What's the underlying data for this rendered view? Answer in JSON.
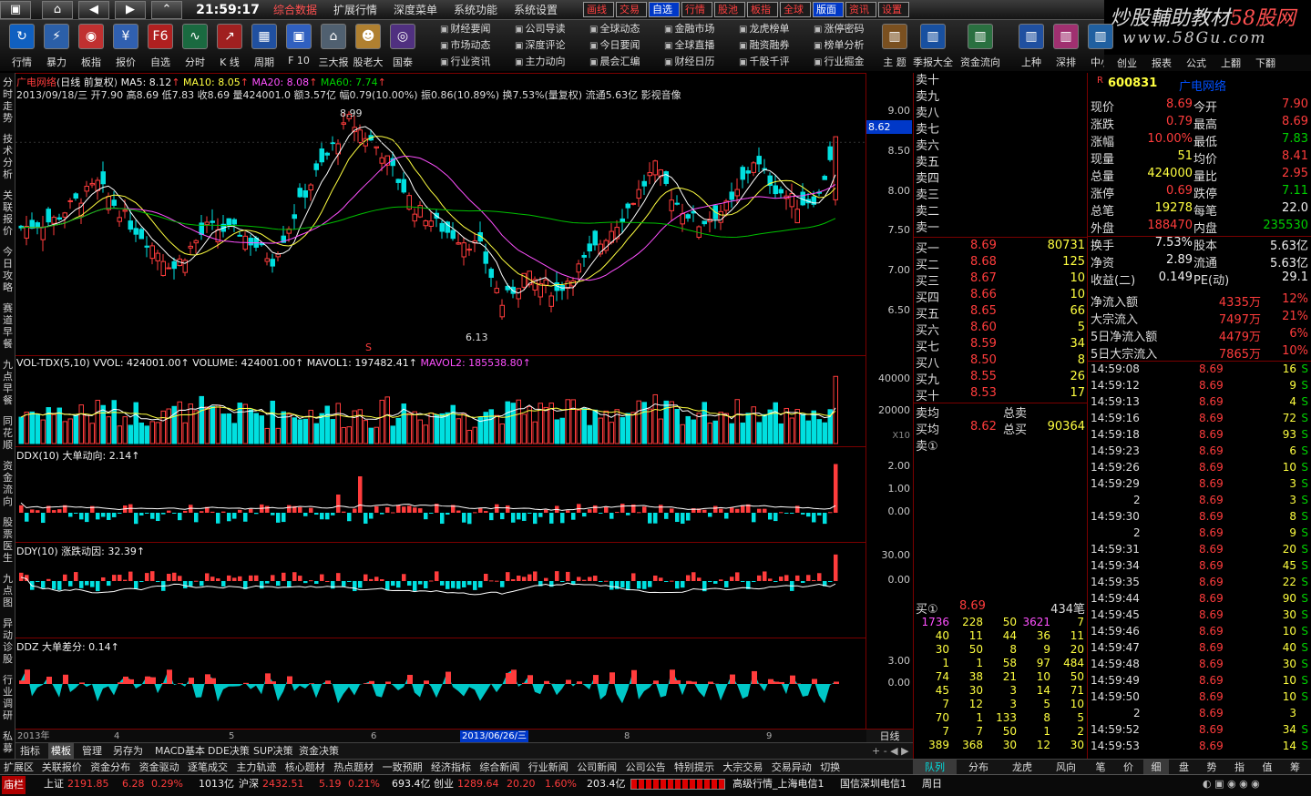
{
  "menubar": {
    "clock": "21:59:17",
    "menus": [
      "综合数据",
      "扩展行情",
      "深度菜单",
      "系统功能",
      "系统设置"
    ],
    "active_menu": "综合数据",
    "top_buttons": [
      "画线",
      "交易",
      "自选",
      "行情",
      "股池",
      "板指",
      "全球",
      "版面",
      "资讯",
      "设置"
    ],
    "highlight_buttons": [
      "自选",
      "版面"
    ]
  },
  "watermark": {
    "line1_a": "炒股輔助教材",
    "line1_b": "58股网",
    "line2": "www.58Gu.com"
  },
  "toolbar": {
    "tools": [
      "行情",
      "暴力",
      "板指",
      "报价",
      "自选",
      "分时",
      "K 线",
      "周期",
      "F 10",
      "三大报",
      "股老大",
      "国泰"
    ],
    "links": [
      "财经要闻",
      "公司导读",
      "全球动态",
      "金融市场",
      "龙虎榜单",
      "涨停密码",
      "市场动态",
      "深度评论",
      "今日要闻",
      "全球直播",
      "融资融券",
      "榜单分析",
      "行业资讯",
      "主力动向",
      "晨会汇编",
      "财经日历",
      "千股千评",
      "行业掘金"
    ],
    "tools_right": [
      "主 题",
      "季报大全",
      "资金流向",
      "上种",
      "深排",
      "中小",
      "创业",
      "报表",
      "公式",
      "上翻",
      "下翻"
    ]
  },
  "left_tabs": [
    "分时走势",
    "技术分析",
    "关联报价",
    "今日攻略",
    "赛道早餐",
    "九点早餐",
    "同花顺",
    "资金流向",
    "股票医生",
    "九点图",
    "异动诊股",
    "行业调研",
    "私募"
  ],
  "kline": {
    "title_code": "广电网络",
    "period": "日线 前复权",
    "ma5": "MA5: 8.12",
    "ma10": "MA10: 8.05",
    "ma20": "MA20: 8.08",
    "ma60": "MA60: 7.74",
    "info_line": "2013/09/18/三 开7.90 高8.69 低7.83 收8.69 量424001.0 额3.57亿 幅0.79(10.00%) 振0.86(10.89%) 换7.53%(量复权) 流通5.63亿 影视音像",
    "high_label": "8.99",
    "low_label": "6.13",
    "s_marker": "S",
    "current_price": "8.62",
    "yticks": [
      "9.00",
      "8.50",
      "8.00",
      "7.50",
      "7.00",
      "6.50"
    ]
  },
  "vol": {
    "title": "VOL-TDX(5,10) VVOL: 424001.00↑   VOLUME: 424001.00↑   MAVOL1: 197482.41↑",
    "mavol2": "MAVOL2: 185538.80↑",
    "yticks": [
      "40000",
      "20000"
    ],
    "unit": "X10"
  },
  "ddx": {
    "title": "DDX(10) 大单动向: 2.14↑",
    "yticks": [
      "2.00",
      "1.00",
      "0.00"
    ]
  },
  "ddy": {
    "title": "DDY(10) 涨跌动因: 32.39↑",
    "yticks": [
      "30.00",
      "0.00"
    ]
  },
  "ddz": {
    "title": "DDZ 大单差分: 0.14↑",
    "yticks": [
      "3.00",
      "0.00"
    ]
  },
  "datebar": {
    "labels": [
      "2013年",
      "4",
      "5",
      "6",
      "2013/06/26/三",
      "8",
      "9"
    ],
    "period_btn": "日线"
  },
  "bottom_tabs1": [
    "指标",
    "模板",
    "管理",
    "另存为",
    "MACD基本",
    "DDE决策",
    "SUP决策",
    "资金决策"
  ],
  "bottom_tabs2": [
    "扩展区",
    "关联报价",
    "资金分布",
    "资金驱动",
    "逐笔成交",
    "主力轨迹",
    "核心题材",
    "热点题材",
    "一致预期",
    "经济指标",
    "综合新闻",
    "行业新闻",
    "公司新闻",
    "公司公告",
    "特别提示",
    "大宗交易",
    "交易异动",
    "切换"
  ],
  "quote_tabs": [
    "队列",
    "分布",
    "龙虎",
    "风向",
    "笔",
    "价",
    "细",
    "盘",
    "势",
    "指",
    "值",
    "筹"
  ],
  "orderbook": {
    "sell_labels": [
      "卖十",
      "卖九",
      "卖八",
      "卖七",
      "卖六",
      "卖五",
      "卖四",
      "卖三",
      "卖二",
      "卖一"
    ],
    "buy": [
      {
        "label": "买一",
        "price": "8.69",
        "vol": "80731"
      },
      {
        "label": "买二",
        "price": "8.68",
        "vol": "125"
      },
      {
        "label": "买三",
        "price": "8.67",
        "vol": "10"
      },
      {
        "label": "买四",
        "price": "8.66",
        "vol": "10"
      },
      {
        "label": "买五",
        "price": "8.65",
        "vol": "66"
      },
      {
        "label": "买六",
        "price": "8.60",
        "vol": "5"
      },
      {
        "label": "买七",
        "price": "8.59",
        "vol": "34"
      },
      {
        "label": "买八",
        "price": "8.50",
        "vol": "8"
      },
      {
        "label": "买九",
        "price": "8.55",
        "vol": "26"
      },
      {
        "label": "买十",
        "price": "8.53",
        "vol": "17"
      }
    ],
    "avg_sell_label": "卖均",
    "total_sell_label": "总卖",
    "avg_buy_label": "买均",
    "avg_buy": "8.62",
    "total_buy_label": "总买",
    "total_buy": "90364",
    "sell_queue_label": "卖①",
    "buy_queue": {
      "label": "买①",
      "price": "8.69",
      "count": "434笔"
    },
    "queue_rows": [
      [
        "1736",
        "228",
        "50",
        "3621",
        "7"
      ],
      [
        "40",
        "11",
        "44",
        "36",
        "11"
      ],
      [
        "30",
        "50",
        "8",
        "9",
        "20"
      ],
      [
        "1",
        "1",
        "58",
        "97",
        "484"
      ],
      [
        "74",
        "38",
        "21",
        "10",
        "50"
      ],
      [
        "45",
        "30",
        "3",
        "14",
        "71"
      ],
      [
        "7",
        "12",
        "3",
        "5",
        "10"
      ],
      [
        "70",
        "1",
        "133",
        "8",
        "5"
      ],
      [
        "7",
        "7",
        "50",
        "1",
        "2"
      ],
      [
        "389",
        "368",
        "30",
        "12",
        "30"
      ]
    ]
  },
  "quote": {
    "code": "600831",
    "name": "广电网络",
    "rows": [
      {
        "l1": "现价",
        "v1": "8.69",
        "l2": "今开",
        "v2": "7.90"
      },
      {
        "l1": "涨跌",
        "v1": "0.79",
        "l2": "最高",
        "v2": "8.69"
      },
      {
        "l1": "涨幅",
        "v1": "10.00%",
        "l2": "最低",
        "v2": "7.83"
      },
      {
        "l1": "现量",
        "v1": "51",
        "l2": "均价",
        "v2": "8.41"
      },
      {
        "l1": "总量",
        "v1": "424000",
        "l2": "量比",
        "v2": "2.95"
      },
      {
        "l1": "涨停",
        "v1": "0.69",
        "l2": "跌停",
        "v2": "7.11"
      },
      {
        "l1": "总笔",
        "v1": "19278",
        "l2": "每笔",
        "v2": "22.0"
      },
      {
        "l1": "外盘",
        "v1": "188470",
        "l2": "内盘",
        "v2": "235530"
      },
      {
        "l1": "换手",
        "v1": "7.53%",
        "l2": "股本",
        "v2": "5.63亿"
      },
      {
        "l1": "净资",
        "v1": "2.89",
        "l2": "流通",
        "v2": "5.63亿"
      },
      {
        "l1": "收益(二)",
        "v1": "0.149",
        "l2": "PE(动)",
        "v2": "29.1"
      }
    ],
    "flows": [
      {
        "label": "净流入额",
        "value": "4335万",
        "pct": "12%"
      },
      {
        "label": "大宗流入",
        "value": "7497万",
        "pct": "21%"
      },
      {
        "label": "5日净流入额",
        "value": "4479万",
        "pct": "6%"
      },
      {
        "label": "5日大宗流入",
        "value": "7865万",
        "pct": "10%"
      }
    ],
    "ticks": [
      [
        "14:59:08",
        "8.69",
        "16",
        "S"
      ],
      [
        "14:59:12",
        "8.69",
        "9",
        "S"
      ],
      [
        "14:59:13",
        "8.69",
        "4",
        "S"
      ],
      [
        "14:59:16",
        "8.69",
        "72",
        "S"
      ],
      [
        "14:59:18",
        "8.69",
        "93",
        "S"
      ],
      [
        "14:59:23",
        "8.69",
        "6",
        "S"
      ],
      [
        "14:59:26",
        "8.69",
        "10",
        "S"
      ],
      [
        "14:59:29",
        "8.69",
        "3",
        "S"
      ],
      [
        "2",
        "8.69",
        "3",
        "S"
      ],
      [
        "14:59:30",
        "8.69",
        "8",
        "S"
      ],
      [
        "2",
        "8.69",
        "9",
        "S"
      ],
      [
        "14:59:31",
        "8.69",
        "20",
        "S"
      ],
      [
        "14:59:34",
        "8.69",
        "45",
        "S"
      ],
      [
        "14:59:35",
        "8.69",
        "22",
        "S"
      ],
      [
        "14:59:44",
        "8.69",
        "90",
        "S"
      ],
      [
        "14:59:45",
        "8.69",
        "30",
        "S"
      ],
      [
        "14:59:46",
        "8.69",
        "10",
        "S"
      ],
      [
        "14:59:47",
        "8.69",
        "40",
        "S"
      ],
      [
        "14:59:48",
        "8.69",
        "30",
        "S"
      ],
      [
        "14:59:49",
        "8.69",
        "10",
        "S"
      ],
      [
        "14:59:50",
        "8.69",
        "10",
        "S"
      ],
      [
        "2",
        "8.69",
        "3",
        ""
      ],
      [
        "14:59:52",
        "8.69",
        "34",
        "S"
      ],
      [
        "14:59:53",
        "8.69",
        "14",
        "S"
      ]
    ]
  },
  "status": {
    "label": "庙栏",
    "sh": {
      "name": "上证",
      "val": "2191.85",
      "chg": "6.28",
      "pct": "0.29%",
      "amt": "1013亿"
    },
    "hs": {
      "name": "沪深",
      "val": "2432.51",
      "chg": "5.19",
      "pct": "0.21%",
      "amt": "693.4亿"
    },
    "cy": {
      "name": "创业",
      "val": "1289.64",
      "chg": "20.20",
      "pct": "1.60%",
      "amt": "203.4亿"
    },
    "t1": "高级行情_上海电信1",
    "t2": "国信深圳电信1",
    "t3": "周日"
  },
  "colors": {
    "up": "#ff3c3c",
    "down": "#00e0e0",
    "ma5": "#ffffff",
    "ma10": "#ffff40",
    "ma20": "#ff50ff",
    "ma60": "#00c000",
    "border": "#7a0000"
  }
}
